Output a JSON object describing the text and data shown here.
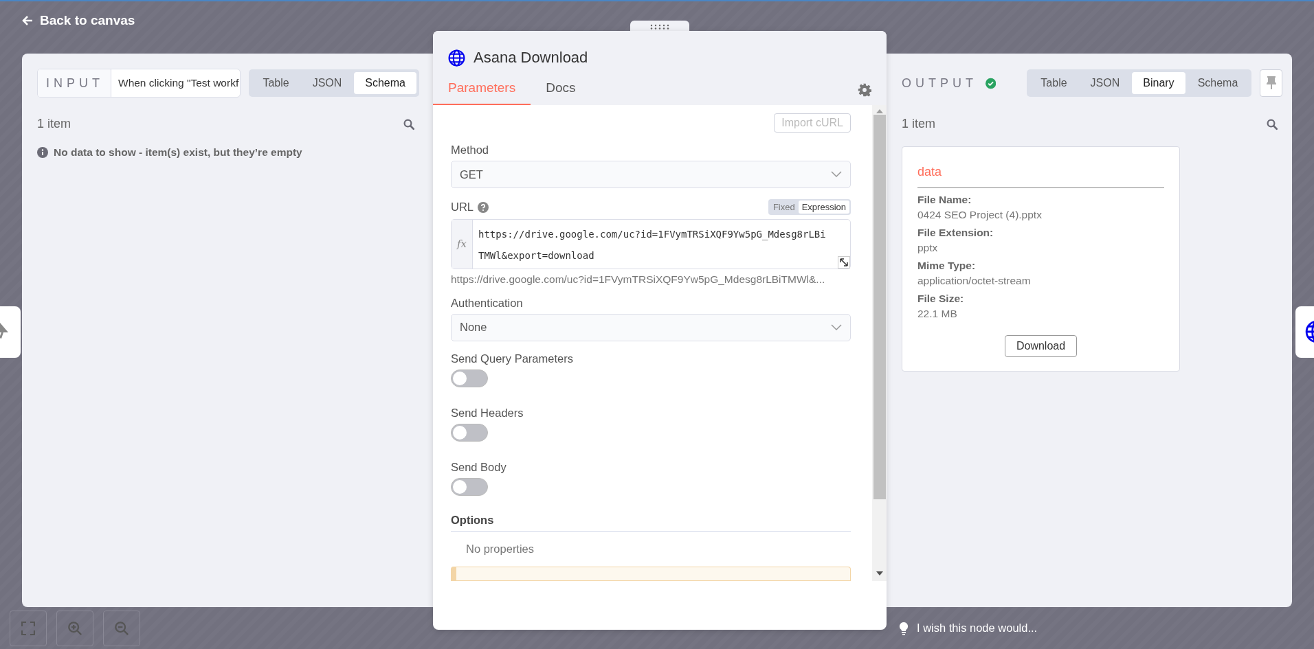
{
  "back_link": "Back to canvas",
  "input": {
    "label": "INPUT",
    "source": "When clicking \"Test workf",
    "tabs": [
      {
        "label": "Table",
        "selected": false
      },
      {
        "label": "JSON",
        "selected": false
      },
      {
        "label": "Schema",
        "selected": true
      }
    ],
    "count": "1 item",
    "message": "No data to show - item(s) exist, but they’re empty"
  },
  "node": {
    "title": "Asana Download",
    "tabs": [
      {
        "label": "Parameters",
        "selected": true
      },
      {
        "label": "Docs",
        "selected": false
      }
    ],
    "import_button": "Import cURL",
    "fields": [
      {
        "kind": "select",
        "label": "Method",
        "value": "GET"
      },
      {
        "kind": "expression",
        "label": "URL",
        "modes": [
          {
            "label": "Fixed",
            "selected": false
          },
          {
            "label": "Expression",
            "selected": true
          }
        ],
        "fx": "fx",
        "value": "https://drive.google.com/uc?id=1FVymTRSiXQF9Yw5pG_Mdesg8rLBiTMWl&export=download",
        "hint": "https://drive.google.com/uc?id=1FVymTRSiXQF9Yw5pG_Mdesg8rLBiTMWl&..."
      },
      {
        "kind": "select",
        "label": "Authentication",
        "value": "None"
      },
      {
        "kind": "toggle",
        "label": "Send Query Parameters",
        "on": false
      },
      {
        "kind": "toggle",
        "label": "Send Headers",
        "on": false
      },
      {
        "kind": "toggle",
        "label": "Send Body",
        "on": false
      }
    ],
    "options": {
      "title": "Options",
      "empty": "No properties"
    }
  },
  "output": {
    "label": "OUTPUT",
    "tabs": [
      {
        "label": "Table",
        "selected": false
      },
      {
        "label": "JSON",
        "selected": false
      },
      {
        "label": "Binary",
        "selected": true
      },
      {
        "label": "Schema",
        "selected": false
      }
    ],
    "count": "1 item",
    "binary": {
      "title": "data",
      "rows": [
        {
          "label": "File Name:",
          "value": "0424 SEO Project (4).pptx"
        },
        {
          "label": "File Extension:",
          "value": "pptx"
        },
        {
          "label": "Mime Type:",
          "value": "application/octet-stream"
        },
        {
          "label": "File Size:",
          "value": "22.1 MB"
        }
      ],
      "button": "Download"
    }
  },
  "feedback": "I wish this node would..."
}
